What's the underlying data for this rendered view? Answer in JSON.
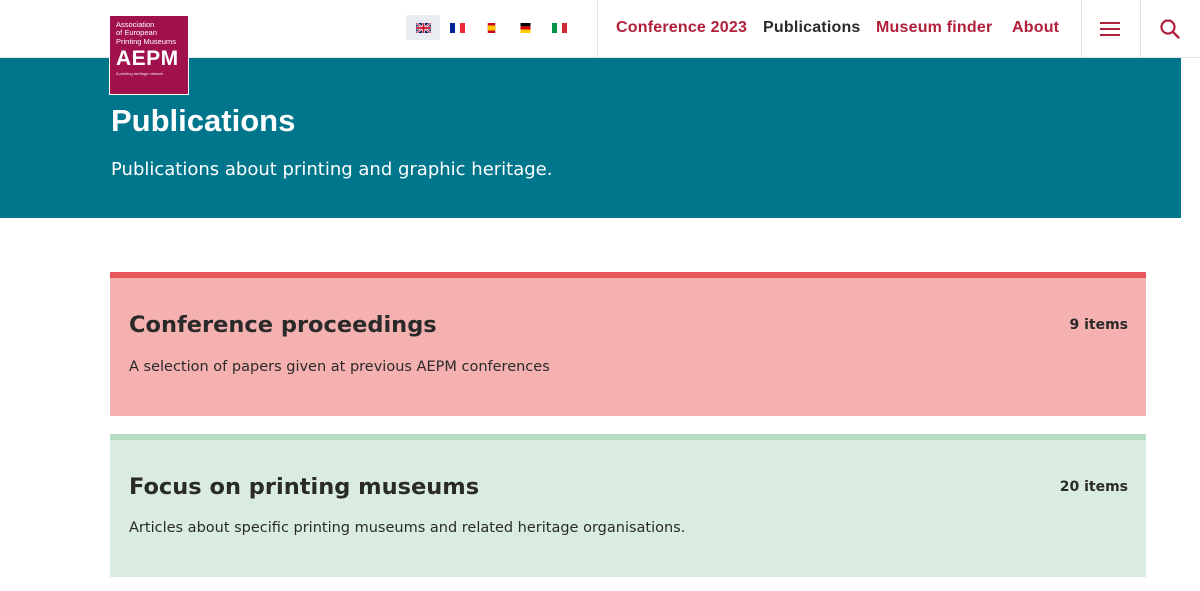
{
  "logo": {
    "line1": "Association",
    "line2": "of European",
    "line3": "Printing Museums",
    "acronym": "AEPM",
    "tagline": "A printing heritage network",
    "color": "#a0114d"
  },
  "languages": [
    {
      "code": "en",
      "icon": "uk-flag-icon",
      "active": true
    },
    {
      "code": "fr",
      "icon": "france-flag-icon",
      "active": false
    },
    {
      "code": "es",
      "icon": "spain-flag-icon",
      "active": false
    },
    {
      "code": "de",
      "icon": "germany-flag-icon",
      "active": false
    },
    {
      "code": "it",
      "icon": "italy-flag-icon",
      "active": false
    }
  ],
  "nav": {
    "items": [
      {
        "label": "Conference 2023",
        "active": false
      },
      {
        "label": "Publications",
        "active": true
      },
      {
        "label": "Museum finder",
        "active": false
      },
      {
        "label": "About",
        "active": false
      }
    ],
    "menu_icon": "hamburger-menu-icon",
    "search_icon": "search-icon"
  },
  "hero": {
    "title": "Publications",
    "subtitle": "Publications about printing and graphic heritage.",
    "background": "#00768c"
  },
  "categories": [
    {
      "title": "Conference proceedings",
      "description": "A selection of papers given at previous AEPM conferences",
      "count": "9 items",
      "background": "#f5b0b0",
      "accent": "#e4565a"
    },
    {
      "title": "Focus on printing museums",
      "description": "Articles about specific printing museums and related heritage organisations.",
      "count": "20 items",
      "background": "#d9ecdf",
      "accent": "#b5dcc3"
    }
  ],
  "colors": {
    "nav_red": "#b0203a",
    "nav_active": "#2b2b2b"
  }
}
